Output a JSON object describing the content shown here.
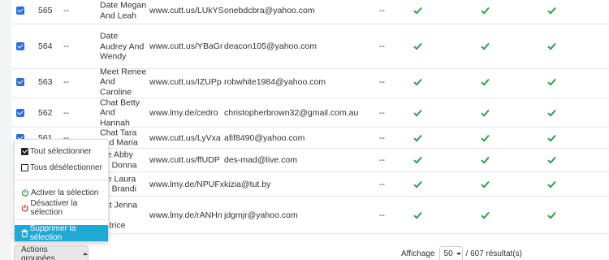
{
  "colors": {
    "checkbox": "#2c6fd6",
    "check_ok": "#2aa24a",
    "menu_active": "#21a9d6",
    "activate_icon": "#3a9a3a",
    "deactivate_icon": "#c0392b"
  },
  "rows": [
    {
      "id": "565",
      "status": "--",
      "name": [
        "Date Megan",
        "And Leah"
      ],
      "url": "www.cutt.us/LUkYS",
      "email": "onebdcbra@yahoo.com",
      "flag": "--"
    },
    {
      "id": "564",
      "status": "--",
      "name": [
        "Date",
        "Audrey And",
        "Wendy"
      ],
      "url": "www.cutt.us/YBaGr",
      "email": "deacon105@yahoo.com",
      "flag": "--"
    },
    {
      "id": "563",
      "status": "--",
      "name": [
        "Meet Renee",
        "And",
        "Caroline"
      ],
      "url": "www.cutt.us/IZUPp",
      "email": "robwhite1984@yahoo.com",
      "flag": "--"
    },
    {
      "id": "562",
      "status": "--",
      "name": [
        "Chat Betty",
        "And",
        "Hannah"
      ],
      "url": "www.lmy.de/cedro",
      "email": "christopherbrown32@gmail.com.au",
      "flag": "--"
    },
    {
      "id": "561",
      "status": "--",
      "name": [
        "Chat Tara",
        "and Maria"
      ],
      "url": "www.cutt.us/LyVxa",
      "email": "afif8490@yahoo.com",
      "flag": "--"
    },
    {
      "id": "",
      "status": "",
      "name": [
        "ate Abby",
        "nd Donna"
      ],
      "url": "www.cutt.us/ffUDP",
      "email": "des-mad@live.com",
      "flag": "--"
    },
    {
      "id": "",
      "status": "",
      "name": [
        "ate Laura",
        "nd Brandi"
      ],
      "url": "www.lmy.de/NPUFx",
      "email": "kizia@tut.by",
      "flag": "--"
    },
    {
      "id": "",
      "status": "",
      "name": [
        "hat Jenna",
        "nd",
        "eatrice"
      ],
      "url": "www.lmy.de/rANHn",
      "email": "jdgmjr@yahoo.com",
      "flag": "--"
    }
  ],
  "menu": {
    "select_all": "Tout sélectionner",
    "deselect_all": "Tous désélectionner",
    "activate": "Activer la sélection",
    "deactivate": "Désactiver la sélection",
    "delete": "Supprimer la sélection"
  },
  "bulk_button": "Actions groupées",
  "pager": {
    "display_label": "Affichage",
    "per_page": "50",
    "total": "/ 607 résultat(s)"
  }
}
